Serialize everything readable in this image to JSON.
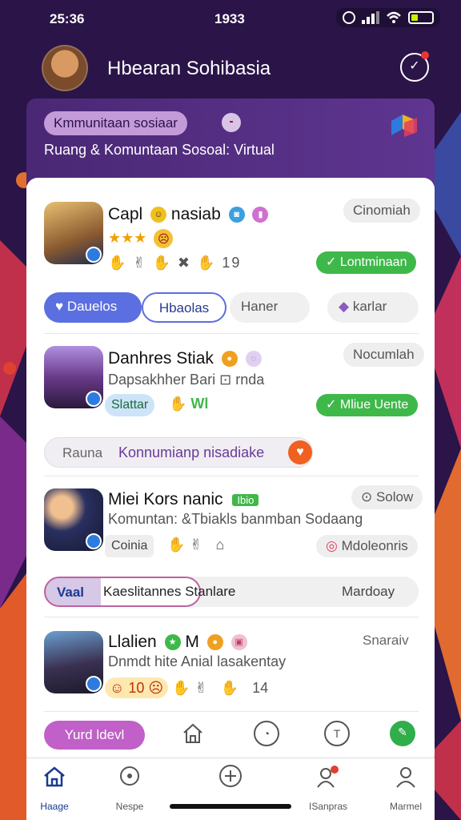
{
  "status_bar": {
    "time": "25:36",
    "center": "1933"
  },
  "header": {
    "title": "Hbearan Sohibasia"
  },
  "banner": {
    "chip_label": "Kmmunitaan sosiaar",
    "subtitle": "Ruang & Komuntaan Sosoal: Virtual"
  },
  "posts": [
    {
      "name": "Capl",
      "name_tail": "nasiab",
      "tag": "Cinomiah",
      "reactions": "19",
      "action_label": "Lontminaan"
    },
    {
      "name": "Danhres Stiak",
      "subtitle": "Dapsakhher Bari",
      "subtitle_tail": "rnda",
      "tag": "Nocumlah",
      "chip": "Slattar",
      "count": "Wl",
      "action_label": "Mliue Uente"
    },
    {
      "name": "Miei Kors nanic",
      "badge": "Ibio",
      "subtitle": "Komuntan:  &Tbiakls banmban Sodaang",
      "tag": "Solow",
      "chip": "Coinia",
      "action_label": "Mdoleonris"
    },
    {
      "name": "Llalien",
      "name_tail": "M",
      "subtitle": "Dnmdt hite Anial lasakentay",
      "tag": "Snaraiv",
      "count": "10",
      "reactions": "14"
    }
  ],
  "tabs_1": [
    "Dauelos",
    "Hbaolas",
    "Haner",
    "karlar"
  ],
  "community_bar": {
    "left": "Rauna",
    "main": "Konnumianp nisadiake"
  },
  "tabs_2": {
    "active": "Vaal",
    "middle": "Kaeslitannes Stanlare",
    "right": "Mardoay"
  },
  "action_row": {
    "primary": "Yurd ldevl"
  },
  "bottom_nav": [
    {
      "label": "Haage",
      "icon": "home-icon"
    },
    {
      "label": "Nespe",
      "icon": "discover-icon"
    },
    {
      "label": "",
      "icon": "add-icon"
    },
    {
      "label": "ISanpras",
      "icon": "groups-icon"
    },
    {
      "label": "Marmel",
      "icon": "profile-icon"
    }
  ],
  "colors": {
    "purple_bg": "#2a1448",
    "green": "#3fb84a",
    "blue": "#5b6fe0",
    "magenta": "#c060c8"
  }
}
